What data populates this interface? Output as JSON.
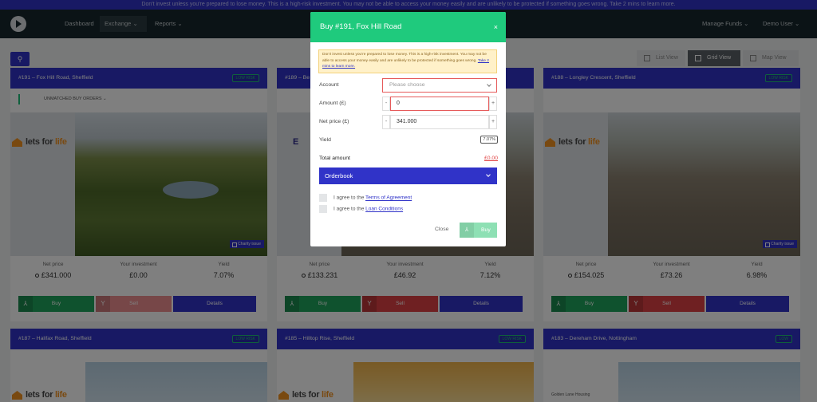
{
  "banner": {
    "text": "Don't invest unless you're prepared to lose money. This is a high-risk investment. You may not be able to access your money easily and are unlikely to be protected if something goes wrong. Take 2 mins to learn more."
  },
  "nav": {
    "dashboard": "Dashboard",
    "exchange": "Exchange",
    "reports": "Reports",
    "manage_funds": "Manage Funds",
    "user": "Demo User"
  },
  "views": {
    "list": "List View",
    "grid": "Grid View",
    "map": "Map View"
  },
  "colors": {
    "primary": "#3033c8",
    "success": "#1fca7d",
    "danger": "#df4144",
    "warning_bg": "#fff1c9"
  },
  "cards": [
    {
      "title": "#191 – Fox Hill Road, Sheffield",
      "badge": "LOW RISK",
      "orders": "UNMATCHED BUY ORDERS",
      "brand_a": "lets for ",
      "brand_b": "life",
      "charity": "Charity issue",
      "net_price_label": "Net price",
      "net_price": "£341.000",
      "investment_label": "Your investment",
      "investment": "£0.00",
      "yield_label": "Yield",
      "yield": "7.07%",
      "buy": "Buy",
      "sell": "Sell",
      "details": "Details"
    },
    {
      "title": "#189 – Be",
      "badge": "",
      "brand_a": "E",
      "charity": "",
      "net_price_label": "Net price",
      "net_price": "£133.231",
      "investment_label": "Your investment",
      "investment": "£46.92",
      "yield_label": "Yield",
      "yield": "7.12%",
      "buy": "Buy",
      "sell": "Sell",
      "details": "Details"
    },
    {
      "title": "#188 – Longley Crescent, Sheffield",
      "badge": "LOW RISK",
      "brand_a": "lets for ",
      "brand_b": "life",
      "charity": "Charity issue",
      "net_price_label": "Net price",
      "net_price": "£154.025",
      "investment_label": "Your investment",
      "investment": "£73.26",
      "yield_label": "Yield",
      "yield": "6.98%",
      "buy": "Buy",
      "sell": "Sell",
      "details": "Details"
    },
    {
      "title": "#187 – Halifax Road, Sheffield",
      "badge": "LOW RISK",
      "brand_a": "lets for ",
      "brand_b": "life"
    },
    {
      "title": "#185 – Hilltop Rise, Sheffield",
      "badge": "LOW RISK",
      "brand_a": "lets for ",
      "brand_b": "life"
    },
    {
      "title": "#183 – Dereham Drive, Nottingham",
      "badge": "LOW",
      "brand_a": "Golden Lane Housing"
    }
  ],
  "modal": {
    "title": "Buy #191, Fox Hill Road",
    "close_icon": "×",
    "warning": "Don't invest unless you're prepared to lose money. This is a high-risk investment. You may not be able to access your money easily and are unlikely to be protected if something goes wrong.",
    "warning_link": "Take 2 mins to learn more.",
    "account_label": "Account",
    "account_placeholder": "Please choose",
    "amount_label": "Amount (£)",
    "amount_value": "0",
    "net_price_label": "Net price (£)",
    "net_price_value": "341.000",
    "yield_label": "Yield",
    "yield_value": "7.07%",
    "total_label": "Total amount",
    "total_value": "£0.00",
    "orderbook": "Orderbook",
    "agree1_prefix": "I agree to the ",
    "agree1_link": "Terms of Agreement",
    "agree2_prefix": "I agree to the ",
    "agree2_link": "Loan Conditions",
    "close": "Close",
    "buy": "Buy"
  }
}
